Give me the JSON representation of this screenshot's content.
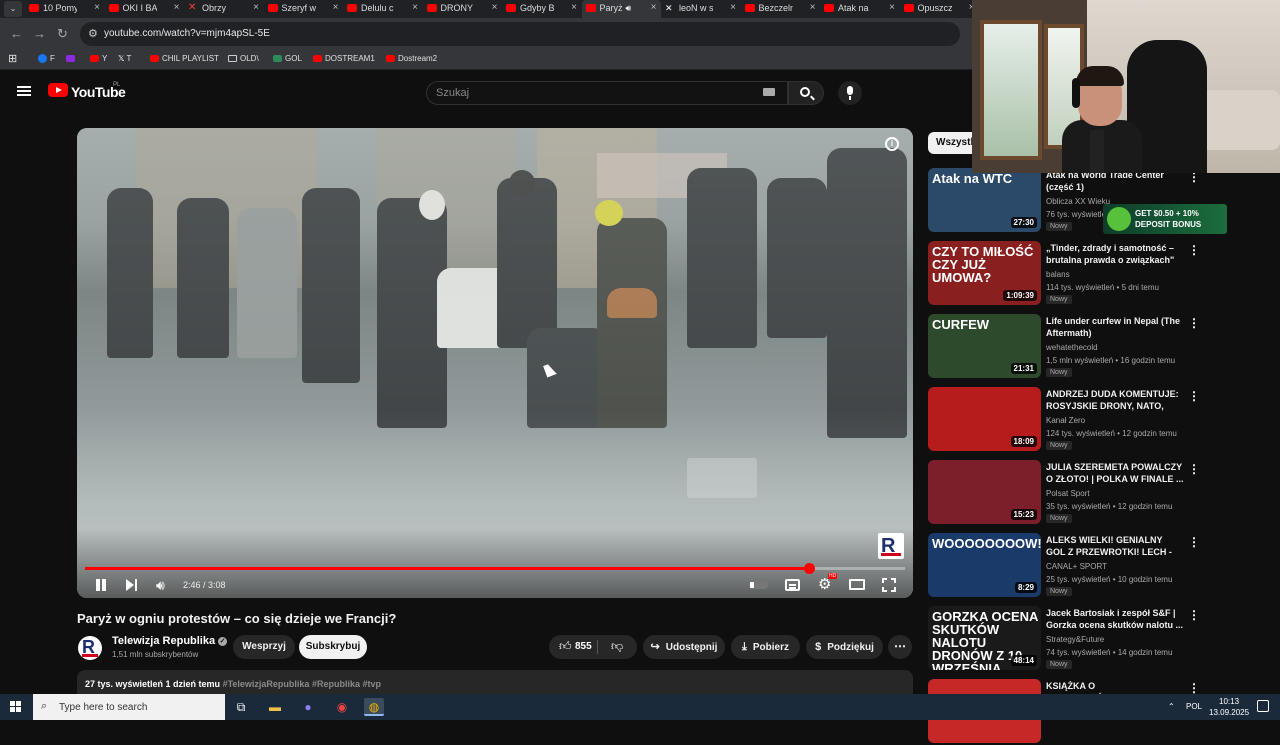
{
  "browser": {
    "tabs": [
      {
        "title": "10 Pomy",
        "icon": "youtube-icon"
      },
      {
        "title": "OKI I BA",
        "icon": "youtube-icon"
      },
      {
        "title": "Obrzy",
        "icon": "x-icon"
      },
      {
        "title": "Szeryf w",
        "icon": "youtube-icon"
      },
      {
        "title": "Delulu c",
        "icon": "youtube-icon"
      },
      {
        "title": "DRONY",
        "icon": "youtube-icon"
      },
      {
        "title": "Gdyby B",
        "icon": "youtube-icon"
      },
      {
        "title": "Paryż",
        "icon": "youtube-icon",
        "active": true
      },
      {
        "title": "leoN w s",
        "icon": "x-icon"
      },
      {
        "title": "Bezczeln",
        "icon": "youtube-icon"
      },
      {
        "title": "Atak na",
        "icon": "youtube-icon"
      },
      {
        "title": "Opuszcz",
        "icon": "youtube-icon"
      }
    ],
    "url": "youtube.com/watch?v=mjm4apSL-5E",
    "bookmarks": [
      {
        "label": "F",
        "icon": "facebook-icon"
      },
      {
        "label": "",
        "icon": "twitch-icon"
      },
      {
        "label": "Y",
        "icon": "youtube-icon"
      },
      {
        "label": "T",
        "icon": "x-icon"
      },
      {
        "label": "CHIL PLAYLIST",
        "icon": "youtube-icon"
      },
      {
        "label": "OLD\\",
        "icon": "folder-icon"
      },
      {
        "label": "GOL",
        "icon": "gol-icon"
      },
      {
        "label": "DOSTREAM1",
        "icon": "youtube-icon"
      },
      {
        "label": "Dostream2",
        "icon": "youtube-icon"
      }
    ]
  },
  "youtube": {
    "logo_text": "YouTube",
    "country": "PL",
    "search_placeholder": "Szukaj"
  },
  "player": {
    "current_time": "2:46 / 3:08",
    "progress_fraction": 0.883,
    "watermark": "R"
  },
  "video": {
    "title": "Paryż w ogniu protestów – co się dzieje we Francji?",
    "channel_initial": "R",
    "channel": "Telewizja Republika",
    "subscribers": "1,51 mln subskrybentów",
    "join_label": "Wesprzyj",
    "subscribe_label": "Subskrybuj",
    "likes": "855",
    "share_label": "Udostępnij",
    "download_label": "Pobierz",
    "thanks_label": "Podziękuj",
    "views_date": "27 tys. wyświetleń  1 dzień temu",
    "hashtags": "#TelewizjaRepublika #Republika #tvp"
  },
  "sidebar": {
    "chip": "Wszystk",
    "recommendations": [
      {
        "title": "Atak na World Trade Center (część 1)",
        "channel": "Oblicza XX Wieku",
        "meta": "76 tys. wyświetleń",
        "badge": "Nowy",
        "duration": "27:30",
        "thumb_text": "Atak na WTC",
        "thumb_color": "#2b4a6a"
      },
      {
        "title": "„Tinder, zdrady i samotność – brutalna prawda o związkach\" ...",
        "channel": "balans",
        "meta": "114 tys. wyświetleń • 5 dni temu",
        "badge": "Nowy",
        "duration": "1:09:39",
        "thumb_text": "CZY TO MIŁOŚĆ CZY JUŻ UMOWA?",
        "thumb_color": "#8a1f1f"
      },
      {
        "title": "Life under curfew in Nepal (The Aftermath)",
        "channel": "wehatethecold",
        "meta": "1,5 mln wyświetleń • 16 godzin temu",
        "badge": "Nowy",
        "duration": "21:31",
        "thumb_text": "CURFEW",
        "thumb_color": "#2d4a2d"
      },
      {
        "title": "ANDRZEJ DUDA KOMENTUJE: ROSYJSKIE DRONY, NATO, CZ...",
        "channel": "Kanał Zero",
        "meta": "124 tys. wyświetleń • 12 godzin temu",
        "badge": "Nowy",
        "duration": "18:09",
        "thumb_text": "",
        "thumb_color": "#b71c1c"
      },
      {
        "title": "JULIA SZEREMETA POWALCZY O ZŁOTO! | POLKA W FINALE ...",
        "channel": "Polsat Sport",
        "meta": "35 tys. wyświetleń • 12 godzin temu",
        "badge": "Nowy",
        "duration": "15:23",
        "thumb_text": "",
        "thumb_color": "#7d1f2a"
      },
      {
        "title": "ALEKS WIELKI! GENIALNY GOL Z PRZEWROTKI! LECH - KGHM...",
        "channel": "CANAL+ SPORT",
        "meta": "25 tys. wyświetleń • 10 godzin temu",
        "badge": "Nowy",
        "duration": "8:29",
        "thumb_text": "WOOOOOOOOW!",
        "thumb_color": "#1a3a6a"
      },
      {
        "title": "Jacek Bartosiak i zespół S&F | Gorzka ocena skutków nalotu ...",
        "channel": "Strategy&Future",
        "meta": "74 tys. wyświetleń • 14 godzin temu",
        "badge": "Nowy",
        "duration": "48:14",
        "thumb_text": "GORZKA OCENA SKUTKÓW NALOTU DRONÓW Z 10 WRZEŚNIA",
        "thumb_color": "#1a1a1a"
      },
      {
        "title": "KSIĄŻKA O BEZPIECZEŃSTWIE.",
        "channel": "",
        "meta": "",
        "badge": "",
        "duration": "",
        "thumb_text": "",
        "thumb_color": "#c62828"
      }
    ]
  },
  "overlay_ad": {
    "text": "GET $0.50 + 10% DEPOSIT BONUS"
  },
  "taskbar": {
    "search_placeholder": "Type here to search",
    "language": "POL",
    "time": "10:13",
    "date": "13.09.2025"
  },
  "colors": {
    "youtube_red": "#ff0000",
    "background": "#0f0f0f",
    "pill": "#272727"
  }
}
